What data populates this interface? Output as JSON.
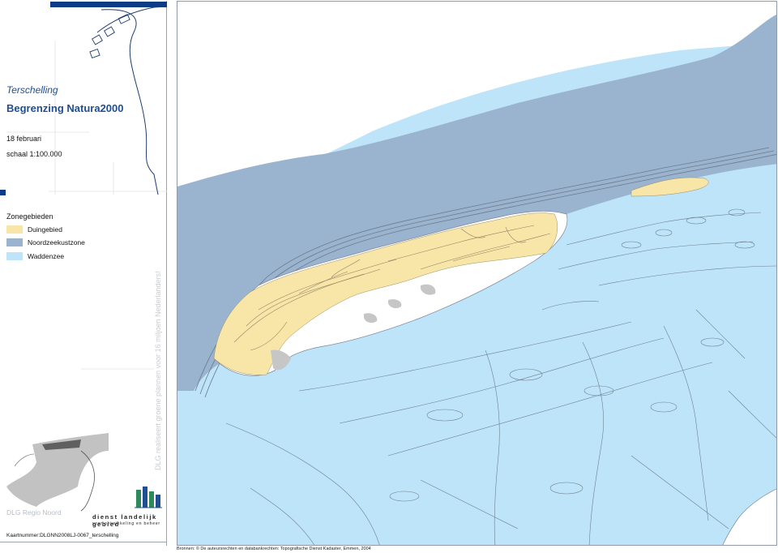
{
  "sidebar": {
    "place": "Terschelling",
    "title": "Begrenzing Natura2000",
    "date": "18 februari",
    "scale": "schaal 1:100.000",
    "legend": {
      "heading": "Zonegebieden",
      "items": [
        {
          "label": "Duingebied",
          "color": "#f8e5a8"
        },
        {
          "label": "Noordzeekustzone",
          "color": "#9ab4d0"
        },
        {
          "label": "Waddenzee",
          "color": "#bde4f8"
        }
      ]
    },
    "vertical_text": "DLG realiseert groene plannen voor 16 miljoen Nederlanders!",
    "regio": "DLG Regio Noord",
    "org_name": "dienst landelijk gebied",
    "org_tagline": "voor ontwikkeling en beheer",
    "map_number": "Kaartnummer:DLGNN2008LJ-0067_terschelling",
    "icons": [
      "dlg-logo-icon",
      "netherlands-overview-icon"
    ]
  },
  "map": {
    "sources": "Bronnen: © De auteursrechten en databankrechten: Topografische Dienst Kadaster, Emmen, 2004",
    "colors": {
      "dune": "#f8e5a8",
      "north_sea_coast": "#9ab4d0",
      "wadden_sea": "#bde4f8",
      "settlement": "#c6c6c6",
      "land": "#ffffff"
    }
  }
}
